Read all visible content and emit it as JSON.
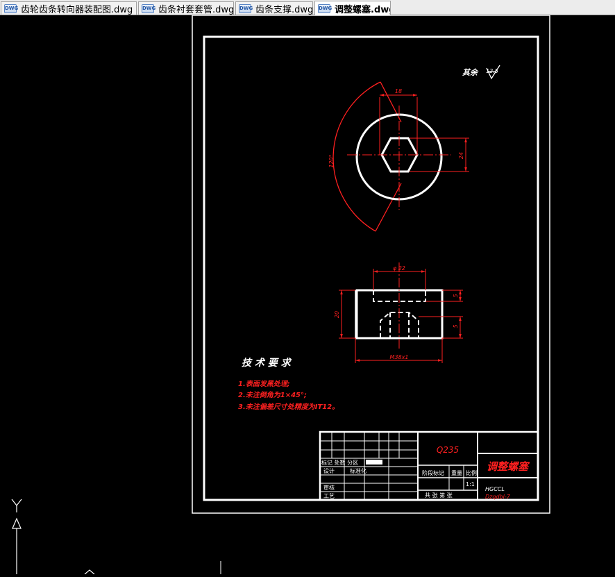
{
  "tabs": [
    {
      "label": "齿轮齿条转向器装配图.dwg",
      "active": false
    },
    {
      "label": "齿条衬套套管.dwg",
      "active": false
    },
    {
      "label": "齿条支撑.dwg",
      "active": false
    },
    {
      "label": "调整螺塞.dwg",
      "active": true
    }
  ],
  "file_icon_text": "DWG",
  "drawing": {
    "roughness_note": "其余",
    "roughness_value": "12.5",
    "dim_hex_width": "18",
    "dim_hex_height": "24",
    "dim_angle": "120°",
    "dim_top_diameter": "φ 22",
    "dim_height_total": "20",
    "dim_height_top": "5",
    "dim_height_bottom": "5",
    "dim_thread": "M38x1",
    "tech_title": "技 术 要 求",
    "tech_notes": [
      "1.表面发黑处理;",
      "2.未注倒角为1×45°;",
      "3.未注偏差尺寸处精度为IT12。"
    ]
  },
  "title_block": {
    "material": "Q235",
    "part_name": "调整螺塞",
    "company": "HGCCL",
    "drawing_no": "Dzqdbl-7",
    "labels": {
      "revision": "标记 处数 分区",
      "design": "设计",
      "standard": "标准化",
      "check": "审核",
      "process": "工艺",
      "stage": "阶段标记",
      "weight": "重量",
      "scale": "比例",
      "scale_value": "1:1",
      "sheets": "共 张  第  张"
    }
  },
  "colors": {
    "drawing_line": "#ffffff",
    "dimension": "#ff2020",
    "background": "#000000"
  },
  "ucs_icon": {
    "y_label": "Y"
  }
}
